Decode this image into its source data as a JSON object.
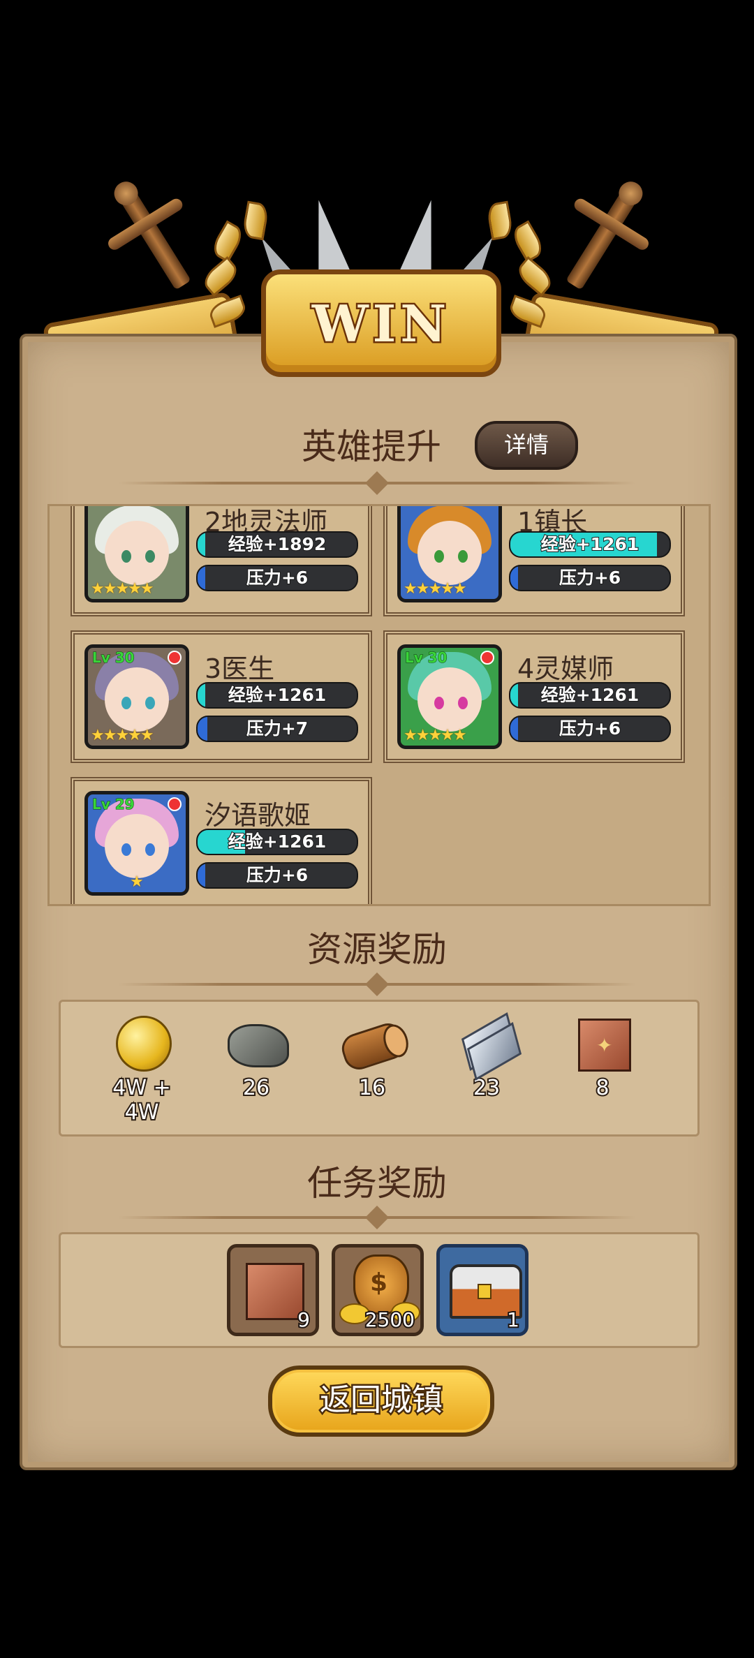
{
  "banner": {
    "title": "WIN"
  },
  "hero_section": {
    "title": "英雄提升",
    "details_label": "详情",
    "heroes": [
      {
        "name": "2地灵法师",
        "level": "",
        "exp": "经验+1892",
        "exp_fill": 0.05,
        "stress": "压力+6",
        "stress_fill": 0.05,
        "stars": 5,
        "hair": "#e8ece6",
        "eye": "#3c8a64",
        "bg": "#7a8a6a"
      },
      {
        "name": "1镇长",
        "level": "",
        "exp": "经验+1261",
        "exp_fill": 0.92,
        "stress": "压力+6",
        "stress_fill": 0.05,
        "stars": 5,
        "hair": "#d88a2a",
        "eye": "#3a9a3a",
        "bg": "#3b6cc4"
      },
      {
        "name": "3医生",
        "level": "Lv 30",
        "exp": "经验+1261",
        "exp_fill": 0.05,
        "stress": "压力+7",
        "stress_fill": 0.06,
        "stars": 5,
        "hair": "#8a80a8",
        "eye": "#3aa6b8",
        "bg": "#7a6a5a"
      },
      {
        "name": "4灵媒师",
        "level": "Lv 30",
        "exp": "经验+1261",
        "exp_fill": 0.05,
        "stress": "压力+6",
        "stress_fill": 0.05,
        "stars": 5,
        "hair": "#59c9a8",
        "eye": "#d63aa0",
        "bg": "#3aa04a"
      },
      {
        "name": "汐语歌姬",
        "level": "Lv 29",
        "exp": "经验+1261",
        "exp_fill": 0.3,
        "stress": "压力+6",
        "stress_fill": 0.05,
        "stars": 1,
        "hair": "#e6a6d8",
        "eye": "#3a7ad6",
        "bg": "#3b6cc4"
      }
    ]
  },
  "resource_section": {
    "title": "资源奖励",
    "items": [
      {
        "icon": "gold-coin-icon",
        "value": "4W + 4W"
      },
      {
        "icon": "stone-icon",
        "value": "26"
      },
      {
        "icon": "wood-log-icon",
        "value": "16"
      },
      {
        "icon": "iron-ingot-icon",
        "value": "23"
      },
      {
        "icon": "leather-icon",
        "value": "8"
      }
    ]
  },
  "task_section": {
    "title": "任务奖励",
    "items": [
      {
        "icon": "leather-icon",
        "count": "9"
      },
      {
        "icon": "money-bag-icon",
        "count": "2500"
      },
      {
        "icon": "treasure-chest-icon",
        "count": "1"
      }
    ]
  },
  "return_button": {
    "label": "返回城镇"
  },
  "colors": {
    "exp_bar": "#27d6d0",
    "stress_bar": "#2f6bd6",
    "panel": "#cbb18d",
    "title_text": "#4a2b1a"
  }
}
